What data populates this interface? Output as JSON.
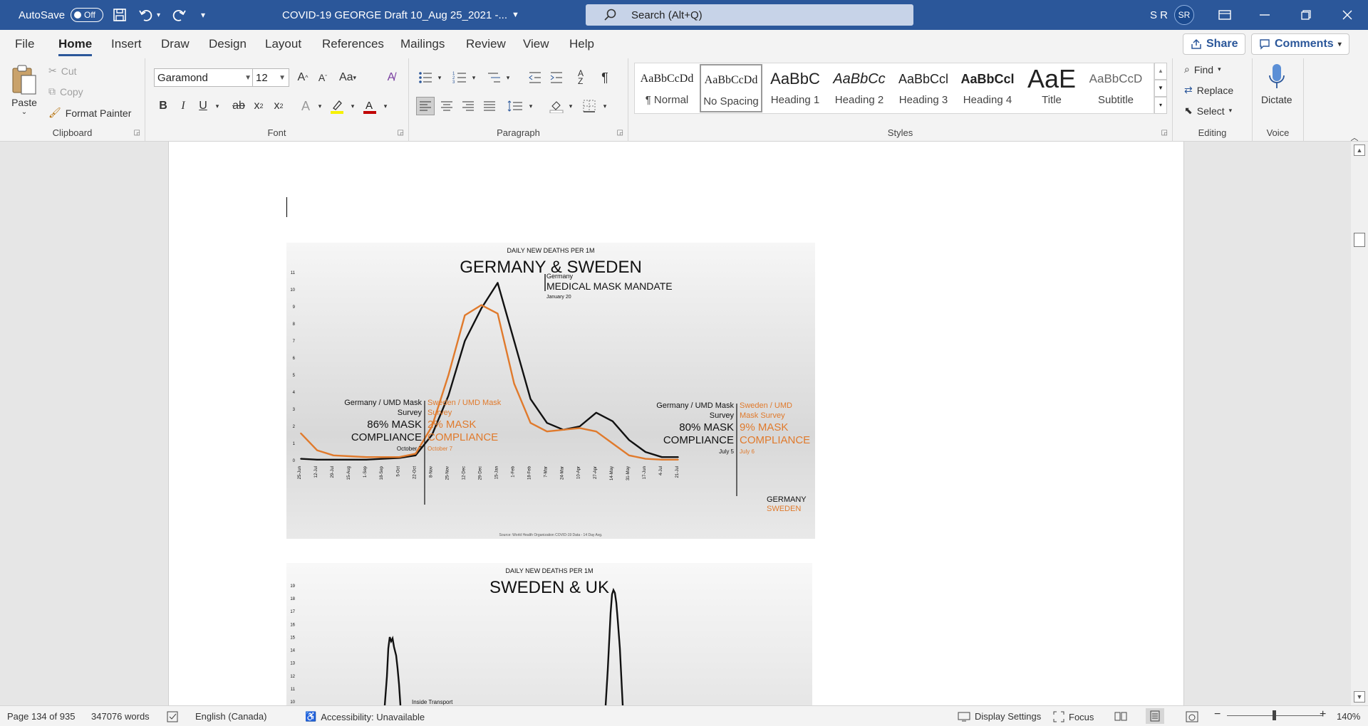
{
  "titlebar": {
    "autosave_label": "AutoSave",
    "autosave_state": "Off",
    "doc_title": "COVID-19 GEORGE Draft 10_Aug 25_2021  -...",
    "search_placeholder": "Search (Alt+Q)",
    "user_initials": "S R",
    "avatar_initials": "SR"
  },
  "menu": {
    "tabs": [
      "File",
      "Home",
      "Insert",
      "Draw",
      "Design",
      "Layout",
      "References",
      "Mailings",
      "Review",
      "View",
      "Help"
    ],
    "share_label": "Share",
    "comments_label": "Comments"
  },
  "ribbon": {
    "clipboard": {
      "paste": "Paste",
      "cut": "Cut",
      "copy": "Copy",
      "format_painter": "Format Painter",
      "label": "Clipboard"
    },
    "font": {
      "name": "Garamond",
      "size": "12",
      "label": "Font"
    },
    "paragraph": {
      "label": "Paragraph"
    },
    "styles": {
      "label": "Styles",
      "items": [
        {
          "preview": "AaBbCcDd",
          "name": "¶ Normal"
        },
        {
          "preview": "AaBbCcDd",
          "name": "No Spacing"
        },
        {
          "preview": "AaBbC",
          "name": "Heading 1"
        },
        {
          "preview": "AaBbCc",
          "name": "Heading 2"
        },
        {
          "preview": "AaBbCcl",
          "name": "Heading 3"
        },
        {
          "preview": "AaBbCcl",
          "name": "Heading 4"
        },
        {
          "preview": "AaE",
          "name": "Title"
        },
        {
          "preview": "AaBbCcD",
          "name": "Subtitle"
        }
      ]
    },
    "editing": {
      "find": "Find",
      "replace": "Replace",
      "select": "Select",
      "label": "Editing"
    },
    "voice": {
      "dictate": "Dictate",
      "label": "Voice"
    }
  },
  "charts": {
    "chart1": {
      "subtitle": "DAILY NEW DEATHS PER 1M",
      "title": "GERMANY & SWEDEN",
      "mandate_country": "Germany",
      "mandate_text": "MEDICAL MASK MANDATE",
      "mandate_date": "January 20",
      "ann_de_1_a": "Germany / UMD Mask",
      "ann_de_1_b": "Survey",
      "ann_de_1_c": "86% MASK",
      "ann_de_1_d": "COMPLIANCE",
      "ann_de_1_e": "October 7",
      "ann_se_1_a": "Sweden / UMD Mask",
      "ann_se_1_b": "Survey",
      "ann_se_1_c": "2% MASK",
      "ann_se_1_d": "COMPLIANCE",
      "ann_se_1_e": "October 7",
      "ann_de_2_a": "Germany / UMD Mask",
      "ann_de_2_b": "Survey",
      "ann_de_2_c": "80% MASK",
      "ann_de_2_d": "COMPLIANCE",
      "ann_de_2_e": "July 5",
      "ann_se_2_a": "Sweden / UMD",
      "ann_se_2_b": "Mask Survey",
      "ann_se_2_c": "9% MASK",
      "ann_se_2_d": "COMPLIANCE",
      "ann_se_2_e": "July 6",
      "legend_germany": "GERMANY",
      "legend_sweden": "SWEDEN",
      "source": "Source: World Health Organization COVID-19 Data - 14 Day Avg."
    },
    "chart2": {
      "subtitle": "DAILY NEW DEATHS PER 1M",
      "title": "SWEDEN & UK",
      "annotation": "Inside Transport"
    }
  },
  "chart_data": [
    {
      "type": "line",
      "title": "GERMANY & SWEDEN",
      "subtitle": "DAILY NEW DEATHS PER 1M",
      "categories": [
        "25-Jun",
        "12-Jul",
        "29-Jul",
        "15-Aug",
        "1-Sep",
        "18-Sep",
        "5-Oct",
        "22-Oct",
        "8-Nov",
        "25-Nov",
        "12-Dec",
        "29-Dec",
        "15-Jan",
        "1-Feb",
        "18-Feb",
        "7-Mar",
        "24-Mar",
        "10-Apr",
        "27-Apr",
        "14-May",
        "31-May",
        "17-Jun",
        "4-Jul",
        "21-Jul"
      ],
      "ylim": [
        0,
        11
      ],
      "yticks": [
        0,
        1,
        2,
        3,
        4,
        5,
        6,
        7,
        8,
        9,
        10,
        11
      ],
      "series": [
        {
          "name": "GERMANY",
          "color": "#111111",
          "values": [
            0.1,
            0.05,
            0.05,
            0.05,
            0.05,
            0.1,
            0.15,
            0.3,
            1.5,
            3.8,
            7.0,
            8.9,
            10.4,
            7.0,
            3.6,
            2.2,
            1.8,
            2.0,
            2.8,
            2.3,
            1.2,
            0.5,
            0.2,
            0.2
          ]
        },
        {
          "name": "SWEDEN",
          "color": "#e07a2c",
          "values": [
            1.6,
            0.6,
            0.3,
            0.25,
            0.2,
            0.2,
            0.2,
            0.4,
            2.0,
            5.0,
            8.5,
            9.1,
            8.6,
            4.5,
            2.2,
            1.7,
            1.8,
            1.9,
            1.7,
            1.0,
            0.3,
            0.1,
            0.05,
            0.05
          ]
        }
      ]
    },
    {
      "type": "line",
      "title": "SWEDEN & UK",
      "subtitle": "DAILY NEW DEATHS PER 1M",
      "ylim": [
        10,
        19
      ],
      "yticks": [
        10,
        11,
        12,
        13,
        14,
        15,
        16,
        17,
        18,
        19
      ],
      "series": [
        {
          "values": [
            14.1,
            18.5
          ]
        }
      ]
    }
  ],
  "statusbar": {
    "page": "Page 134 of 935",
    "words": "347076 words",
    "language": "English (Canada)",
    "accessibility": "Accessibility: Unavailable",
    "display_settings": "Display Settings",
    "focus": "Focus",
    "zoom": "140%"
  }
}
